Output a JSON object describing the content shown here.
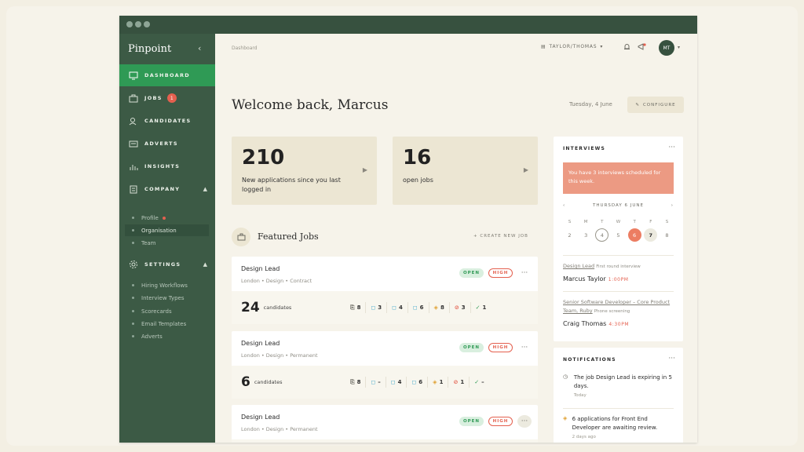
{
  "app": {
    "brand": "Pinpoint"
  },
  "sidebar": {
    "items": [
      {
        "key": "dashboard",
        "label": "DASHBOARD"
      },
      {
        "key": "jobs",
        "label": "JOBS",
        "badge": "1"
      },
      {
        "key": "candidates",
        "label": "CANDIDATES"
      },
      {
        "key": "adverts",
        "label": "ADVERTS"
      },
      {
        "key": "insights",
        "label": "INSIGHTS"
      },
      {
        "key": "company",
        "label": "COMPANY"
      },
      {
        "key": "settings",
        "label": "SETTINGS"
      }
    ],
    "company_sub": [
      "Profile",
      "Organisation",
      "Team"
    ],
    "settings_sub": [
      "Hiring Workflows",
      "Interview Types",
      "Scorecards",
      "Email Templates",
      "Adverts"
    ]
  },
  "header": {
    "breadcrumb": "Dashboard",
    "org": "TAYLOR/THOMAS",
    "avatar": "MT"
  },
  "page": {
    "title": "Welcome back, Marcus",
    "date": "Tuesday, 4 June",
    "configure": "CONFIGURE"
  },
  "stats": [
    {
      "value": "210",
      "label": "New applications since you last logged in"
    },
    {
      "value": "16",
      "label": "open jobs"
    }
  ],
  "featured": {
    "title": "Featured Jobs",
    "create": "+ CREATE NEW JOB",
    "jobs": [
      {
        "title": "Design Lead",
        "meta": "London • Design • Contract",
        "status": "OPEN",
        "priority": "HIGH",
        "candidates": "24",
        "candidates_label": "candidates",
        "stages": [
          "8",
          "3",
          "4",
          "6",
          "8",
          "3",
          "1"
        ]
      },
      {
        "title": "Design Lead",
        "meta": "London • Design • Permanent",
        "status": "OPEN",
        "priority": "HIGH",
        "candidates": "6",
        "candidates_label": "candidates",
        "stages": [
          "8",
          "–",
          "4",
          "6",
          "1",
          "1",
          "–"
        ]
      },
      {
        "title": "Design Lead",
        "meta": "London • Design • Permanent",
        "status": "OPEN",
        "priority": "HIGH",
        "candidates": "",
        "candidates_label": "",
        "stages": []
      }
    ]
  },
  "interviews": {
    "title": "INTERVIEWS",
    "alert": "You have 3 interviews scheduled for this week.",
    "calendar_label": "THURSDAY 6 JUNE",
    "dow": [
      "S",
      "M",
      "T",
      "W",
      "T",
      "F",
      "S"
    ],
    "days": [
      "2",
      "3",
      "4",
      "5",
      "6",
      "7",
      "8"
    ],
    "list": [
      {
        "job": "Design Lead",
        "type": "First round interview",
        "name": "Marcus Taylor",
        "time": "1:00PM"
      },
      {
        "job": "Senior Software Developer – Core Product Team, Ruby",
        "type": "Phone screening",
        "name": "Craig Thomas",
        "time": "4:30PM"
      }
    ]
  },
  "notifications": {
    "title": "NOTIFICATIONS",
    "items": [
      {
        "text": "The job Design Lead is expiring in 5 days.",
        "when": "Today"
      },
      {
        "text": "6 applications for Front End Developer are awaiting review.",
        "when": "2 days ago"
      }
    ]
  },
  "colors": {
    "sidebar": "#3c5a45",
    "active": "#2f9a55",
    "accent": "#e4604f",
    "alert": "#ec9a83",
    "card": "#ece6d3"
  }
}
